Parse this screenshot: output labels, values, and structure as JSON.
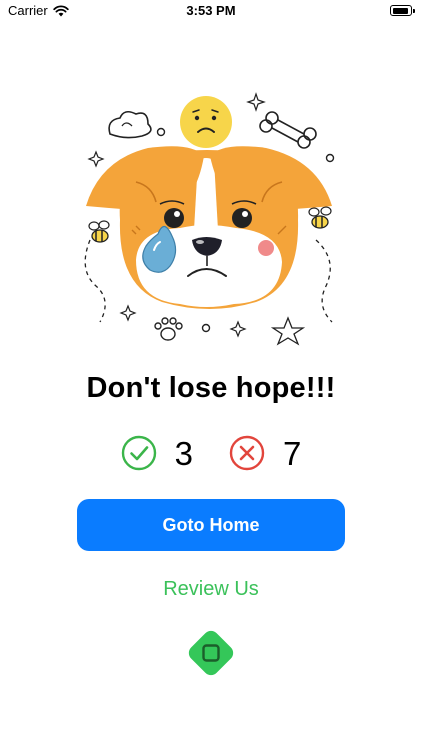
{
  "status_bar": {
    "carrier": "Carrier",
    "time": "3:53 PM",
    "wifi_icon": "wifi-icon",
    "battery_icon": "battery-icon"
  },
  "illustration": {
    "subject": "sad-crying-dog-illustration"
  },
  "headline": "Don't lose hope!!!",
  "score": {
    "correct_icon": "check-circle-icon",
    "correct_count": "3",
    "correct_color": "#3bb54a",
    "wrong_icon": "x-circle-icon",
    "wrong_count": "7",
    "wrong_color": "#e2453c"
  },
  "actions": {
    "goto_home_label": "Goto Home",
    "goto_home_color": "#0a7cff",
    "review_label": "Review Us",
    "review_color": "#3bc15a",
    "stop_icon": "stop-square-icon",
    "stop_color": "#34c759"
  }
}
